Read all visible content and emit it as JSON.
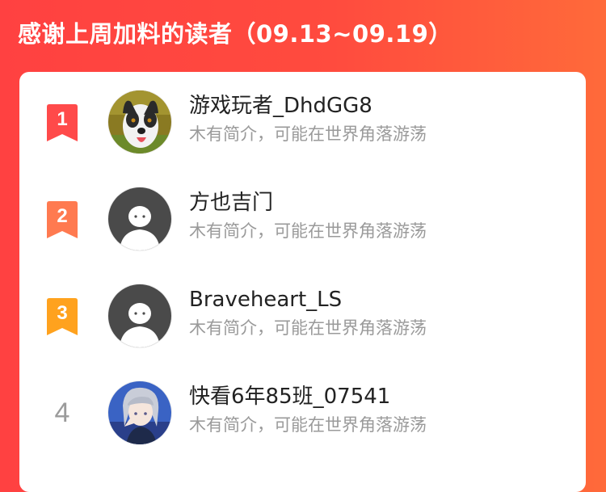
{
  "header": {
    "title": "感谢上周加料的读者（09.13~09.19）"
  },
  "readers": [
    {
      "rank": "1",
      "badge_color": "#ff4a4a",
      "username": "游戏玩者_DhdGG8",
      "bio": "木有简介，可能在世界角落游荡",
      "avatar_icon": "dog-photo-avatar"
    },
    {
      "rank": "2",
      "badge_color": "#ff7a50",
      "username": "方也吉门",
      "bio": "木有简介，可能在世界角落游荡",
      "avatar_icon": "default-person-avatar"
    },
    {
      "rank": "3",
      "badge_color": "#ffa21e",
      "username": "Braveheart_LS",
      "bio": "木有简介，可能在世界角落游荡",
      "avatar_icon": "default-person-avatar"
    },
    {
      "rank": "4",
      "username": "快看6年85班_07541",
      "bio": "木有简介，可能在世界角落游荡",
      "avatar_icon": "anime-character-avatar"
    }
  ]
}
